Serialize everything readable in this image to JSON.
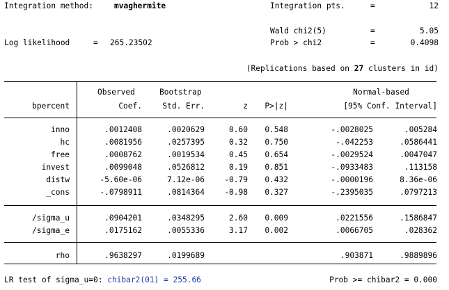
{
  "header": {
    "integration_method_label": "Integration method:",
    "integration_method_value": "mvaghermite",
    "integration_pts_label": "Integration pts.",
    "integration_pts_eq": "=",
    "integration_pts_value": "12",
    "wald_label": "Wald chi2(5)",
    "wald_eq": "=",
    "wald_value": "5.05",
    "loglik_label": "Log likelihood",
    "loglik_eq": "=",
    "loglik_value": "265.23502",
    "prob_label": "Prob > chi2",
    "prob_eq": "=",
    "prob_value": "0.4098",
    "replications_prefix": "(Replications based on",
    "replications_count": "27",
    "replications_suffix": "clusters in id)"
  },
  "table_header": {
    "depvar": "bpercent",
    "observed_top": "Observed",
    "observed_bottom": "Coef.",
    "bootstrap_top": "Bootstrap",
    "bootstrap_bottom": "Std. Err.",
    "z": "z",
    "p": "P>|z|",
    "normal_top": "Normal-based",
    "normal_bottom": "[95% Conf. Interval]"
  },
  "rows_main": [
    {
      "name": "inno",
      "coef": ".0012408",
      "se": ".0020629",
      "z": "0.60",
      "p": "0.548",
      "lo": "-.0028025",
      "hi": ".005284"
    },
    {
      "name": "hc",
      "coef": ".0081956",
      "se": ".0257395",
      "z": "0.32",
      "p": "0.750",
      "lo": "-.042253",
      "hi": ".0586441"
    },
    {
      "name": "free",
      "coef": ".0008762",
      "se": ".0019534",
      "z": "0.45",
      "p": "0.654",
      "lo": "-.0029524",
      "hi": ".0047047"
    },
    {
      "name": "invest",
      "coef": ".0099048",
      "se": ".0526812",
      "z": "0.19",
      "p": "0.851",
      "lo": "-.0933483",
      "hi": ".113158"
    },
    {
      "name": "distw",
      "coef": "-5.60e-06",
      "se": "7.12e-06",
      "z": "-0.79",
      "p": "0.432",
      "lo": "-.0000196",
      "hi": "8.36e-06"
    },
    {
      "name": "_cons",
      "coef": "-.0798911",
      "se": ".0814364",
      "z": "-0.98",
      "p": "0.327",
      "lo": "-.2395035",
      "hi": ".0797213"
    }
  ],
  "rows_sigma": [
    {
      "name": "/sigma_u",
      "coef": ".0904201",
      "se": ".0348295",
      "z": "2.60",
      "p": "0.009",
      "lo": ".0221556",
      "hi": ".1586847"
    },
    {
      "name": "/sigma_e",
      "coef": ".0175162",
      "se": ".0055336",
      "z": "3.17",
      "p": "0.002",
      "lo": ".0066705",
      "hi": ".028362"
    }
  ],
  "row_rho": {
    "name": "rho",
    "coef": ".9638297",
    "se": ".0199689",
    "z": "",
    "p": "",
    "lo": ".903871",
    "hi": ".9889896"
  },
  "footer": {
    "lr_label": "LR test of sigma_u=0:",
    "lr_stat": "chibar2(01) = 255.66",
    "prob_label": "Prob >= chibar2 = 0.000"
  },
  "colors": {
    "text": "#000000",
    "highlight": "#1f3aa8",
    "background": "#ffffff"
  }
}
